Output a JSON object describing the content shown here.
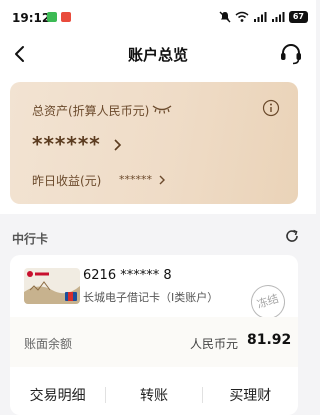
{
  "status_bar": {
    "time": "19:12",
    "battery": "67"
  },
  "nav": {
    "title": "账户总览"
  },
  "asset_summary": {
    "label": "总资产(折算人民币元)",
    "masked_total": "******",
    "yesterday_label": "昨日收益(元)",
    "yesterday_value": "******"
  },
  "section": {
    "title": "中行卡"
  },
  "card": {
    "number": "6216 ****** 8",
    "name": "长城电子借记卡（I类账户）",
    "status_stamp": "冻结",
    "balance_label": "账面余额",
    "currency": "人民币元",
    "balance": "81.92"
  },
  "actions": [
    {
      "label": "交易明细"
    },
    {
      "label": "转账"
    },
    {
      "label": "买理财"
    }
  ],
  "colors": {
    "card_gradient_start": "#f2e3d2",
    "card_gradient_end": "#ead3b8",
    "asset_text": "#6b4a2c"
  }
}
